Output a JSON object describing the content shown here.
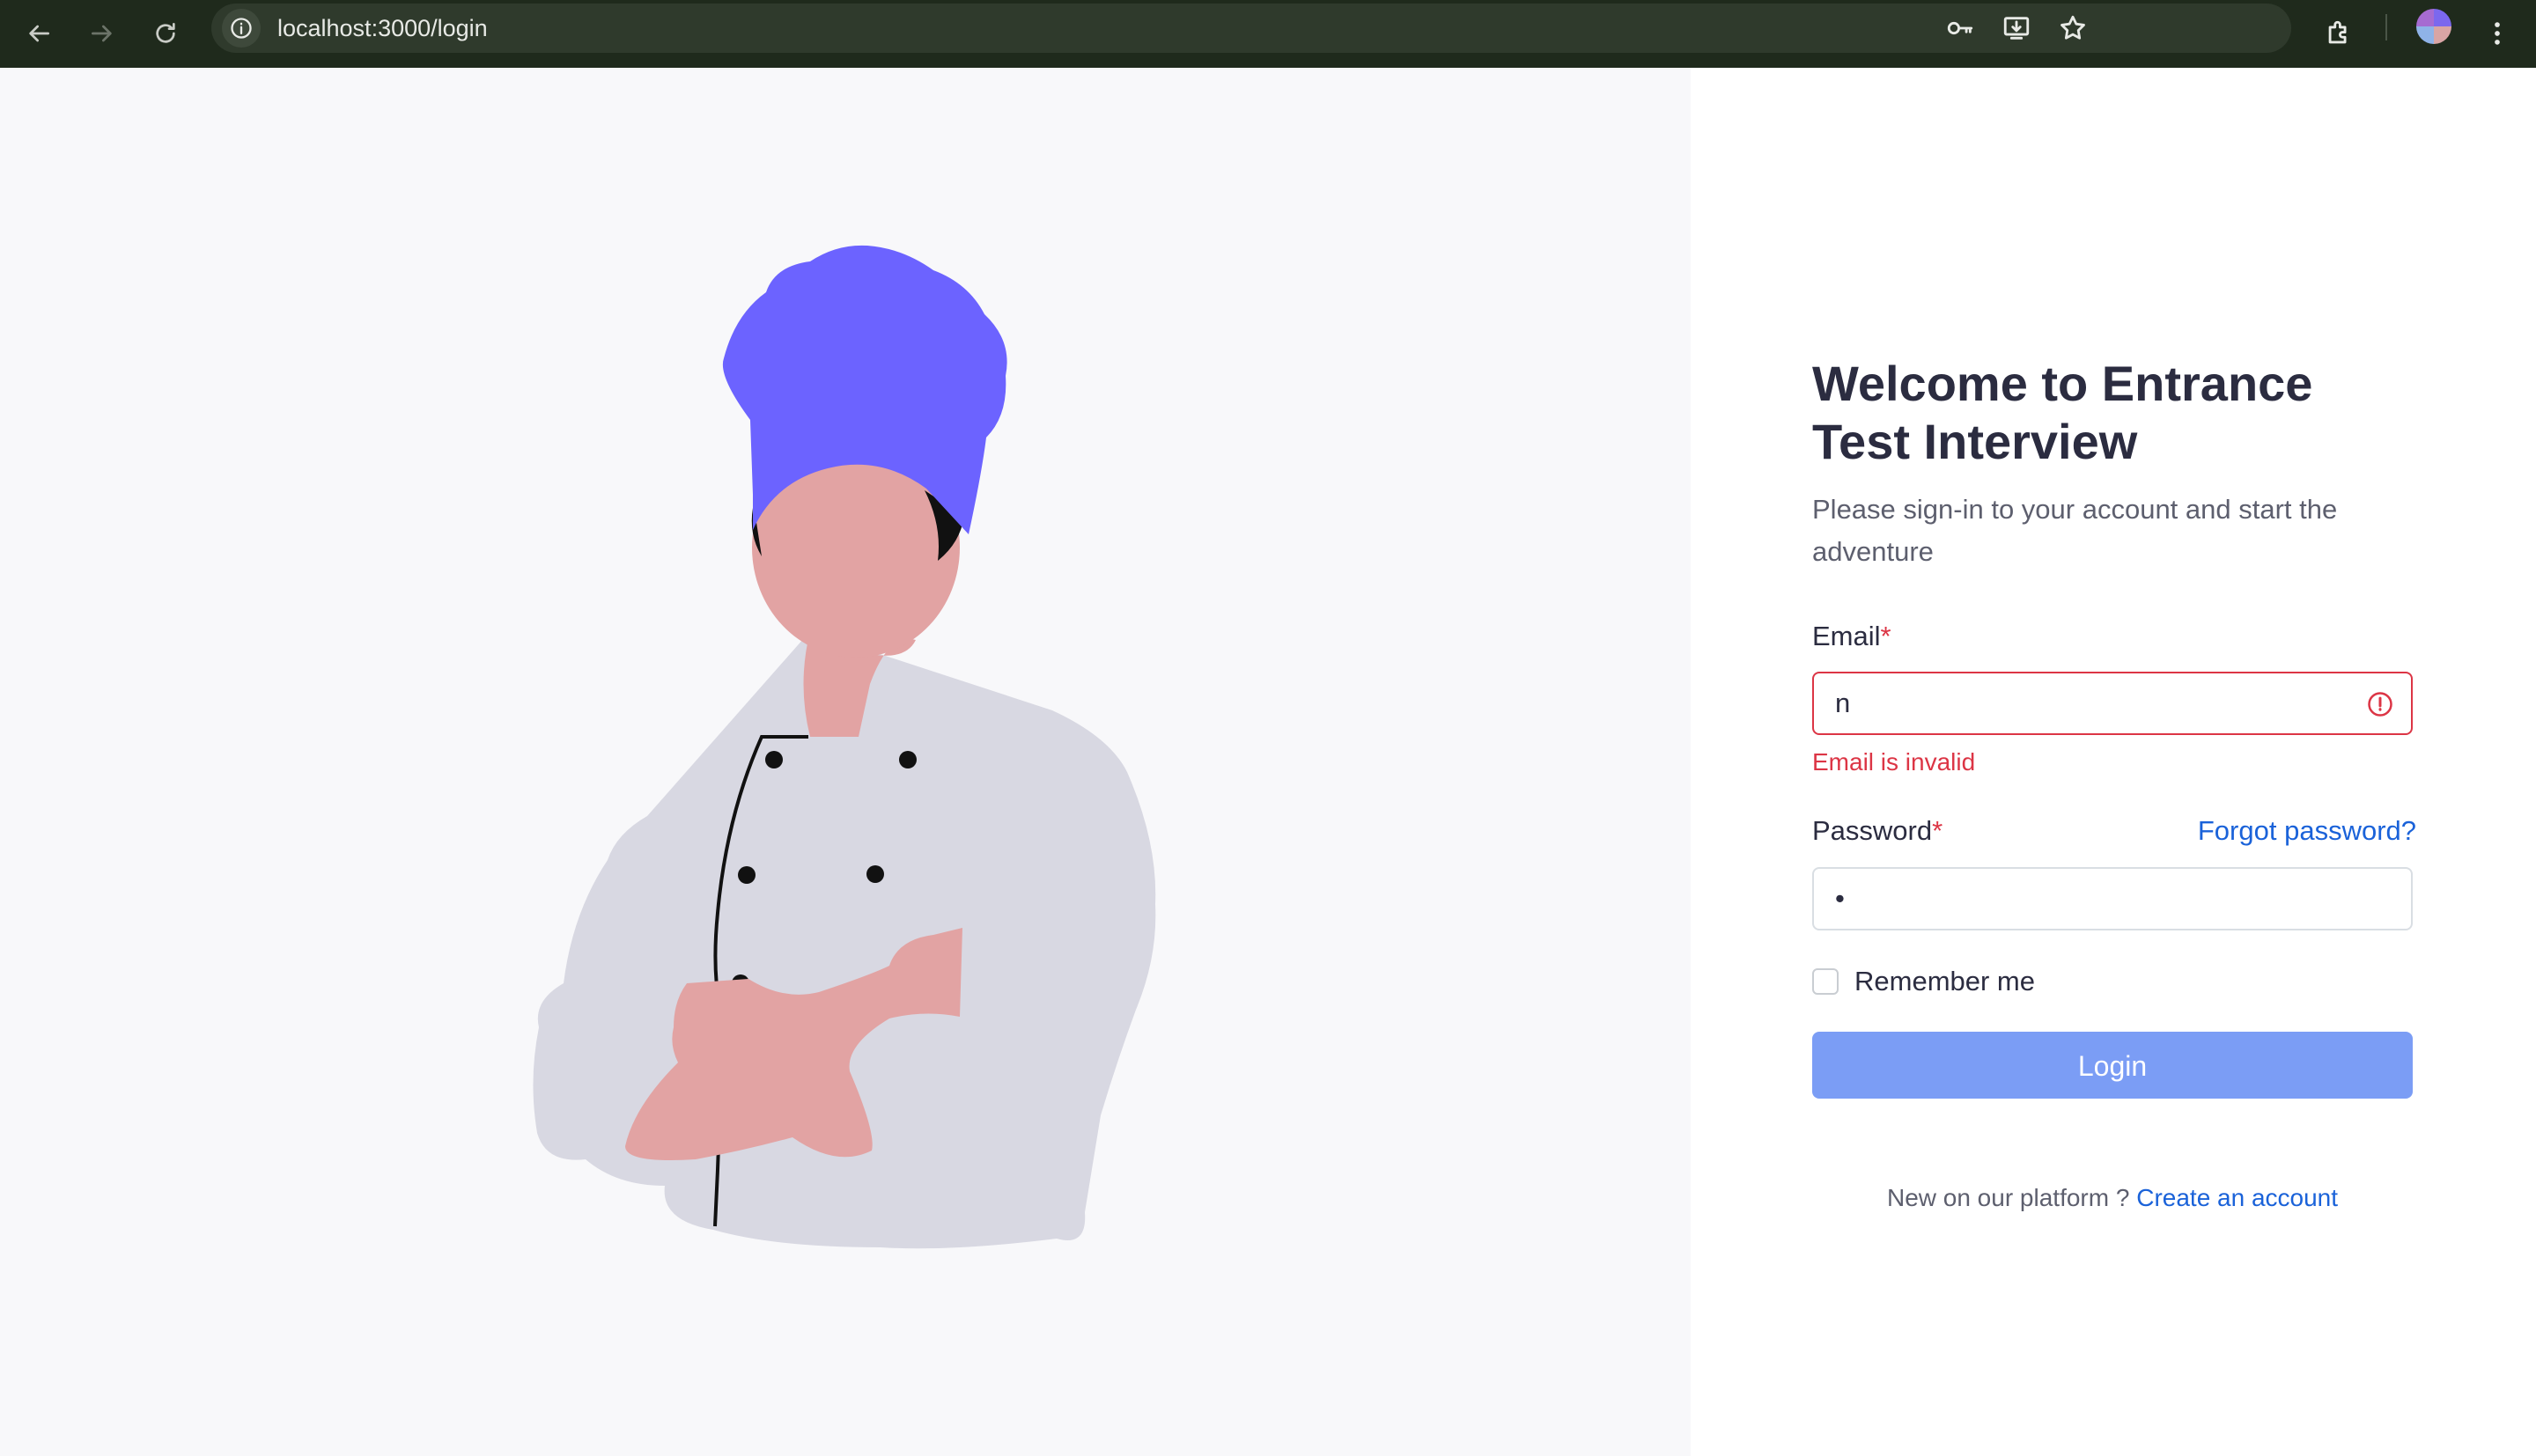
{
  "browser": {
    "url": "localhost:3000/login",
    "icons": {
      "back": "arrow-left-icon",
      "forward": "arrow-right-icon",
      "reload": "reload-icon",
      "site_info": "info-icon",
      "password_key": "key-icon",
      "install_app": "install-icon",
      "bookmark": "star-icon",
      "extensions": "puzzle-icon",
      "menu": "kebab-menu-icon"
    }
  },
  "login": {
    "title": "Welcome to Entrance Test Interview",
    "subtitle": "Please sign-in to your account and start the adventure",
    "email_label": "Email",
    "email_value": "n",
    "email_error": "Email is invalid",
    "password_label": "Password",
    "password_value": "•",
    "required_mark": "*",
    "forgot_password": "Forgot password?",
    "remember_me": "Remember me",
    "login_button": "Login",
    "signup_prompt": "New on our platform ?",
    "signup_link": "Create an account"
  },
  "colors": {
    "primary": "#1a62d9",
    "button": "#7b9df5",
    "error": "#dc3545",
    "chef_hat": "#6c63ff",
    "skin": "#e2a3a3",
    "jacket": "#d8d8e2"
  }
}
